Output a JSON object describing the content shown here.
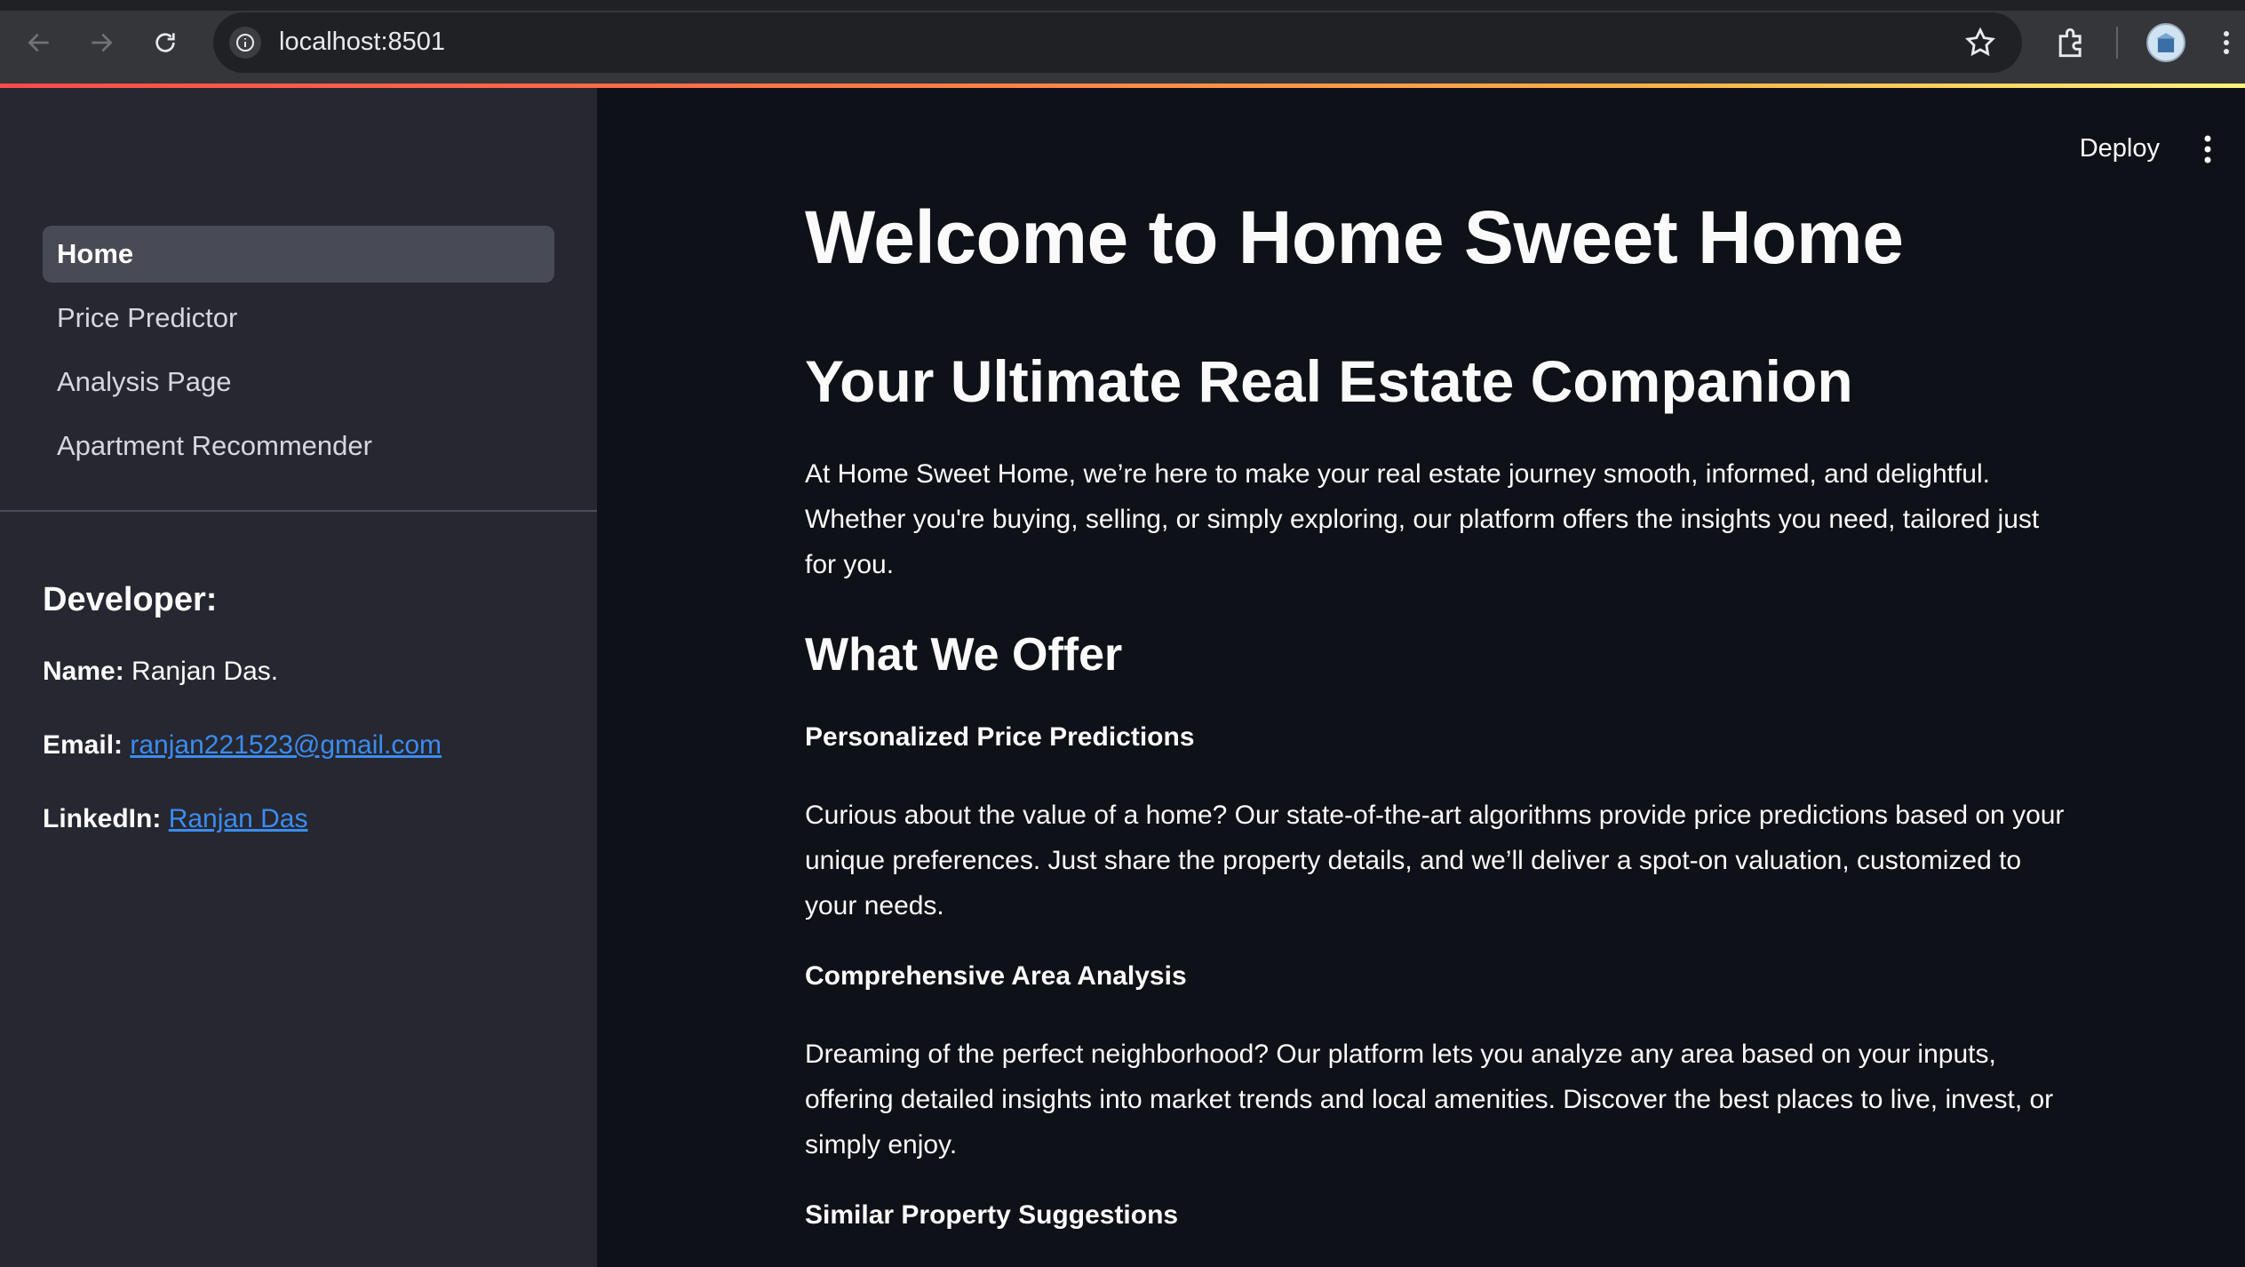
{
  "browser": {
    "url": "localhost:8501",
    "icons": [
      "back-icon",
      "forward-icon",
      "reload-icon",
      "site-info-icon",
      "bookmark-star-icon",
      "extensions-icon",
      "profile-avatar",
      "browser-menu-icon"
    ]
  },
  "theme": {
    "accent": "#ff4b4b",
    "link": "#3b8cf0",
    "sidebar_bg": "#262730",
    "main_bg": "#0e1117"
  },
  "sidebar": {
    "nav": [
      {
        "label": "Home",
        "active": true
      },
      {
        "label": "Price Predictor",
        "active": false
      },
      {
        "label": "Analysis Page",
        "active": false
      },
      {
        "label": "Apartment Recommender",
        "active": false
      }
    ],
    "developer": {
      "heading": "Developer:",
      "name_label": "Name:",
      "name_value": "Ranjan Das.",
      "email_label": "Email:",
      "email_value": "ranjan221523@gmail.com",
      "linkedin_label": "LinkedIn:",
      "linkedin_value": "Ranjan Das"
    }
  },
  "toolbar": {
    "deploy_label": "Deploy"
  },
  "main": {
    "title": "Welcome to Home Sweet Home",
    "subtitle": "Your Ultimate Real Estate Companion",
    "intro": "At Home Sweet Home, we’re here to make your real estate journey smooth, informed, and delightful. Whether you're buying, selling, or simply exploring, our platform offers the insights you need, tailored just for you.",
    "offer_heading": "What We Offer",
    "sections": [
      {
        "title": "Personalized Price Predictions",
        "body": "Curious about the value of a home? Our state-of-the-art algorithms provide price predictions based on your unique preferences. Just share the property details, and we’ll deliver a spot-on valuation, customized to your needs."
      },
      {
        "title": "Comprehensive Area Analysis",
        "body": "Dreaming of the perfect neighborhood? Our platform lets you analyze any area based on your inputs, offering detailed insights into market trends and local amenities. Discover the best places to live, invest, or simply enjoy."
      },
      {
        "title": "Similar Property Suggestions",
        "body": ""
      }
    ]
  }
}
